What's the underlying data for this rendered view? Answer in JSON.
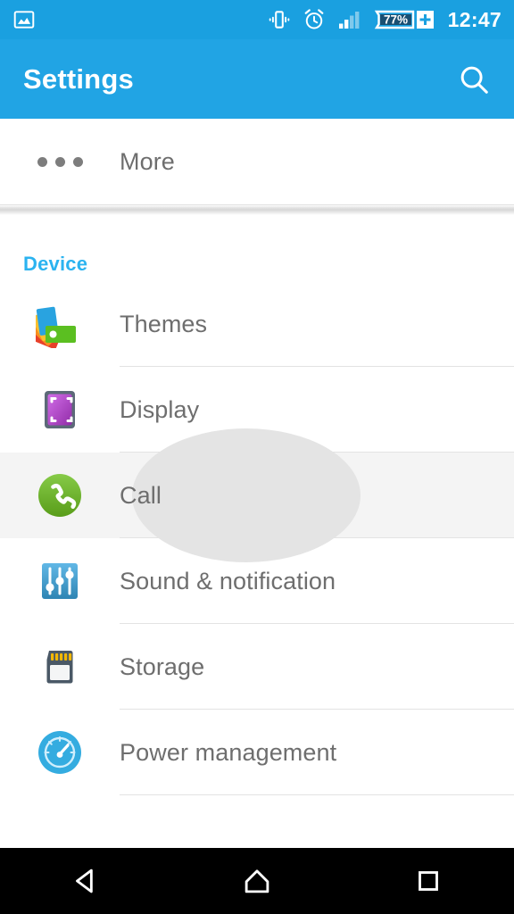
{
  "status_bar": {
    "notification_icon": "image-notification-icon",
    "icons": [
      "vibrate-icon",
      "alarm-icon",
      "signal-icon",
      "battery-icon"
    ],
    "battery_percent": "77%",
    "charging_indicator": "+",
    "signal_bars_filled": 2,
    "signal_bars_total": 4,
    "time": "12:47",
    "background_color": "#1aa0e0"
  },
  "action_bar": {
    "title": "Settings",
    "search_icon": "search-icon",
    "background_color": "#21a4e4"
  },
  "top_list": {
    "items": [
      {
        "label": "More",
        "icon": "more-dots-icon"
      }
    ]
  },
  "sections": [
    {
      "header": "Device",
      "header_color": "#2bb3f0",
      "items": [
        {
          "label": "Themes",
          "icon": "themes-palette-icon",
          "pressed": false
        },
        {
          "label": "Display",
          "icon": "display-icon",
          "pressed": false
        },
        {
          "label": "Call",
          "icon": "call-phone-icon",
          "pressed": true
        },
        {
          "label": "Sound & notification",
          "icon": "sound-sliders-icon",
          "pressed": false
        },
        {
          "label": "Storage",
          "icon": "storage-sdcard-icon",
          "pressed": false
        },
        {
          "label": "Power management",
          "icon": "power-gauge-icon",
          "pressed": false
        }
      ]
    }
  ],
  "nav_bar": {
    "buttons": [
      {
        "name": "back-button",
        "icon": "back-triangle-icon"
      },
      {
        "name": "home-button",
        "icon": "home-icon"
      },
      {
        "name": "recents-button",
        "icon": "recents-square-icon"
      }
    ],
    "background_color": "#000000"
  }
}
